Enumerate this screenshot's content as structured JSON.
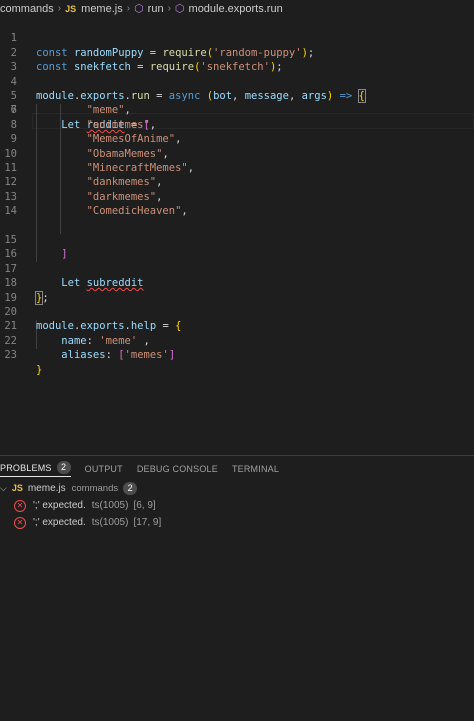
{
  "breadcrumb": {
    "folder": "commands",
    "js_badge": "JS",
    "file": "meme.js",
    "symbol1": "run",
    "symbol2": "module.exports.run"
  },
  "editor": {
    "lines": [
      {
        "n": "1"
      },
      {
        "n": "2"
      },
      {
        "n": "3"
      },
      {
        "n": "4"
      },
      {
        "n": "5"
      },
      {
        "n": "6"
      },
      {
        "n": "7"
      },
      {
        "n": "8"
      },
      {
        "n": "9"
      },
      {
        "n": "10"
      },
      {
        "n": "11"
      },
      {
        "n": "12"
      },
      {
        "n": "13"
      },
      {
        "n": "14"
      },
      {
        "n": "15"
      },
      {
        "n": "16"
      },
      {
        "n": "17"
      },
      {
        "n": "18"
      },
      {
        "n": "19"
      },
      {
        "n": "20"
      },
      {
        "n": "21"
      },
      {
        "n": "22"
      },
      {
        "n": "23"
      }
    ],
    "tokens": {
      "const": "const",
      "randomPuppy": "randomPuppy",
      "snekfetch": "snekfetch",
      "eq": " = ",
      "require": "require",
      "random_puppy_str": "'random-puppy'",
      "snekfetch_str": "'snekfetch'",
      "module": "module",
      "exports": "exports",
      "run": "run",
      "help": "help",
      "async": "async",
      "bot": "bot",
      "message": "message",
      "args": "args",
      "Let": "Let",
      "reddit": "reddit",
      "subreddit": "subreddit",
      "items": [
        "\"meme\"",
        "\"animemes\"",
        "\"MemesOfAnime\"",
        "\"ObamaMemes\"",
        "\"MinecraftMemes\"",
        "\"dankmemes\"",
        "\"darkmemes\"",
        "\"ComedicHeaven\""
      ],
      "name_key": "name",
      "name_val": "'meme'",
      "aliases_key": "aliases",
      "aliases_val": "'memes'"
    }
  },
  "panel": {
    "tabs": [
      {
        "label": "PROBLEMS",
        "count": "2"
      },
      {
        "label": "OUTPUT"
      },
      {
        "label": "DEBUG CONSOLE"
      },
      {
        "label": "TERMINAL"
      }
    ],
    "file": {
      "badge": "JS",
      "name": "meme.js",
      "dir": "commands",
      "count": "2"
    },
    "problems": [
      {
        "message": "';' expected.",
        "source": "ts(1005)",
        "location": "[6, 9]"
      },
      {
        "message": "';' expected.",
        "source": "ts(1005)",
        "location": "[17, 9]"
      }
    ]
  },
  "colors": {
    "error": "#f14c4c",
    "keyword": "#569cd6",
    "string": "#ce9178",
    "function": "#dcdcaa",
    "variable": "#9cdcfe"
  }
}
